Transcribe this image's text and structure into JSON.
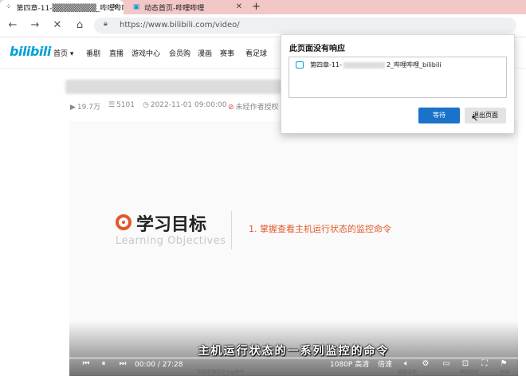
{
  "browser": {
    "tabs": [
      {
        "label": "第四章-11-▒▒▒▒▒▒▒▒_哔哩哔哩",
        "icon": "loading-icon"
      },
      {
        "label": "动态首页-哔哩哔哩",
        "icon": "bilibili-icon"
      }
    ],
    "new_tab": "+",
    "url": "https://www.bilibili.com/video/"
  },
  "site": {
    "logo": "bilibili",
    "nav": [
      "首页",
      "番剧",
      "直播",
      "游戏中心",
      "会员购",
      "漫画",
      "赛事",
      "看足球"
    ],
    "nav_home_arrow": "▾"
  },
  "video": {
    "views": "19.7万",
    "danmaku": "5101",
    "date": "2022-11-01 09:00:00",
    "notice": "未经作者授权"
  },
  "slide": {
    "heading": "学习目标",
    "heading_en": "Learning Objectives",
    "objective": "1.  掌握查看主机运行状态的监控命令"
  },
  "player": {
    "subtitle": "主机运行状态的一系列监控的命令",
    "time": "00:00 / 27:28",
    "quality": "1080P 高清",
    "speed": "倍速",
    "bottom_labels": [
      "系统资源监控  top命令",
      "磁盘监控",
      "网络监控",
      "总结"
    ]
  },
  "dialog": {
    "title": "此页面没有响应",
    "item_prefix": "第四章-11-",
    "item_suffix": "2_哔哩哔哩_bilibili",
    "wait_label": "等待",
    "exit_label": "退出页面"
  },
  "colors": {
    "tab_bar": "#f4c7c7",
    "bilibili_blue": "#00a1d6",
    "accent_orange": "#e0592a",
    "wait_button": "#1a73c9"
  }
}
